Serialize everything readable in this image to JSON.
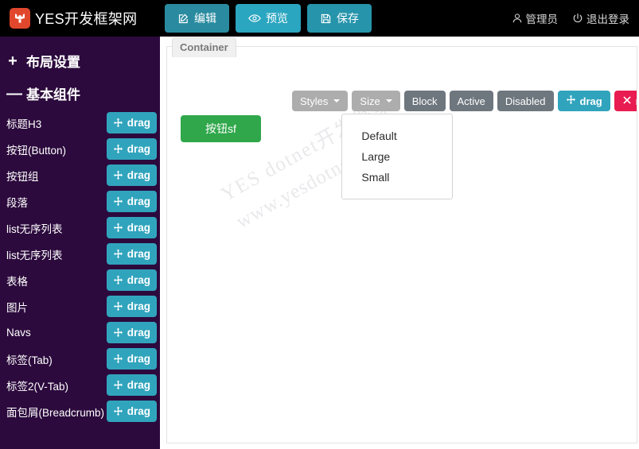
{
  "header": {
    "brand": "YES开发框架网",
    "logo_icon": "yes-logo-icon",
    "actions": [
      {
        "label": "编辑",
        "icon": "edit-square-icon",
        "style": "edit"
      },
      {
        "label": "预览",
        "icon": "eye-icon",
        "style": "preview"
      },
      {
        "label": "保存",
        "icon": "save-floppy-icon",
        "style": "save"
      }
    ],
    "user": {
      "label": "管理员",
      "icon": "user-icon"
    },
    "logout": {
      "label": "退出登录",
      "icon": "power-icon"
    }
  },
  "sidebar": {
    "groups": [
      {
        "title": "布局设置",
        "symbol": "+",
        "collapsed": true
      },
      {
        "title": "基本组件",
        "symbol": "—",
        "collapsed": false
      }
    ],
    "drag_label": "drag",
    "drag_icon": "move-arrows-icon",
    "items": [
      {
        "label": "标题H3"
      },
      {
        "label": "按钮(Button)"
      },
      {
        "label": "按钮组"
      },
      {
        "label": "段落"
      },
      {
        "label": "list无序列表"
      },
      {
        "label": "list无序列表"
      },
      {
        "label": "表格"
      },
      {
        "label": "图片"
      },
      {
        "label": "Navs"
      },
      {
        "label": "标签(Tab)"
      },
      {
        "label": "标签2(V-Tab)"
      },
      {
        "label": "面包屑(Breadcrumb)"
      }
    ]
  },
  "main": {
    "tab_label": "Container",
    "preview_button_label": "按钮sf",
    "toolbar": {
      "styles_label": "Styles",
      "size_label": "Size",
      "block_label": "Block",
      "active_label": "Active",
      "disabled_label": "Disabled",
      "drag_label": "drag",
      "drag_icon": "move-arrows-icon",
      "remove_label": "remove",
      "remove_icon": "close-x-icon"
    },
    "size_dropdown": {
      "open": true,
      "options": [
        "Default",
        "Large",
        "Small"
      ]
    },
    "watermark": {
      "line1": "YES  dotnet开发框架",
      "line2": "www.yesdotnet.com"
    }
  },
  "colors": {
    "header_bg": "#000000",
    "sidebar_bg": "#2c0a3d",
    "teal": "#31a4bd",
    "teal_dark": "#2a8ba0",
    "pink": "#e81c50",
    "green": "#2fa74a",
    "gray_light": "#adadad",
    "gray_dark": "#6e767e",
    "logo_red": "#e0472c"
  }
}
